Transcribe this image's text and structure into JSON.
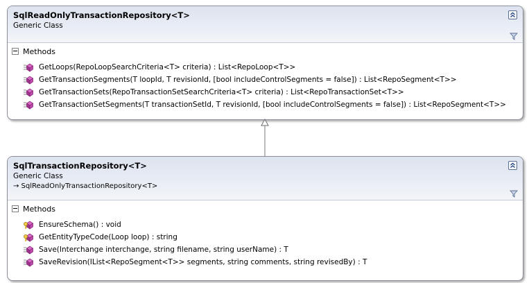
{
  "classes": [
    {
      "name": "SqlReadOnlyTransactionRepository<T>",
      "kind": "Generic Class",
      "base": "",
      "section": "Methods",
      "methods": [
        {
          "signature": "GetLoops(RepoLoopSearchCriteria<T> criteria) : List<RepoLoop<T>>",
          "icon": "public-method-icon"
        },
        {
          "signature": "GetTransactionSegments(T loopId, T revisionId, [bool includeControlSegments = false]) : List<RepoSegment<T>>",
          "icon": "public-method-icon"
        },
        {
          "signature": "GetTransactionSets(RepoTransactionSetSearchCriteria<T>  criteria)  : List<RepoTransactionSet<T>>",
          "icon": "public-method-icon"
        },
        {
          "signature": "GetTransactionSetSegments(T transactionSetId, T revisionId, [bool includeControlSegments = false]) : List<RepoSegment<T>>",
          "icon": "public-method-icon"
        }
      ]
    },
    {
      "name": "SqlTransactionRepository<T>",
      "kind": "Generic Class",
      "base": "→ SqlReadOnlyTransactionRepository<T>",
      "section": "Methods",
      "methods": [
        {
          "signature": "EnsureSchema() : void",
          "icon": "protected-method-icon"
        },
        {
          "signature": "GetEntityTypeCode(Loop loop) : string",
          "icon": "protected-method-icon"
        },
        {
          "signature": "Save(Interchange interchange, string filename, string userName) : T",
          "icon": "public-method-icon"
        },
        {
          "signature": "SaveRevision(IList<RepoSegment<T>> segments, string comments, string revisedBy) : T",
          "icon": "public-method-icon"
        }
      ]
    }
  ],
  "colors": {
    "header_top": "#dde3ef",
    "border": "#8a8f99",
    "method_icon": "#b33fa0"
  }
}
